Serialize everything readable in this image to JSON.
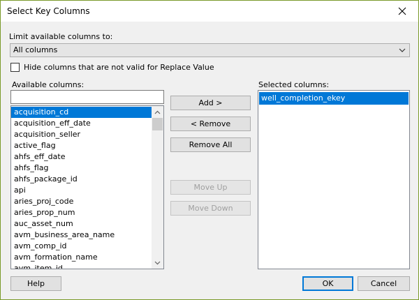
{
  "window": {
    "title": "Select Key Columns"
  },
  "limit": {
    "label": "Limit available columns to:",
    "value": "All columns"
  },
  "hide_invalid": {
    "label": "Hide columns that are not valid for Replace Value",
    "checked": false
  },
  "available": {
    "label": "Available columns:",
    "filter_value": "",
    "items": [
      "acquisition_cd",
      "acquisition_eff_date",
      "acquisition_seller",
      "active_flag",
      "ahfs_eff_date",
      "ahfs_flag",
      "ahfs_package_id",
      "api",
      "aries_proj_code",
      "aries_prop_num",
      "auc_asset_num",
      "avm_business_area_name",
      "avm_comp_id",
      "avm_formation_name",
      "avm_item_id"
    ],
    "selected_item": "acquisition_cd"
  },
  "actions": {
    "add": "Add >",
    "remove": "< Remove",
    "remove_all": "Remove All",
    "move_up": "Move Up",
    "move_down": "Move Down"
  },
  "selected": {
    "label": "Selected columns:",
    "items": [
      "well_completion_ekey"
    ]
  },
  "footer": {
    "help": "Help",
    "ok": "OK",
    "cancel": "Cancel"
  }
}
